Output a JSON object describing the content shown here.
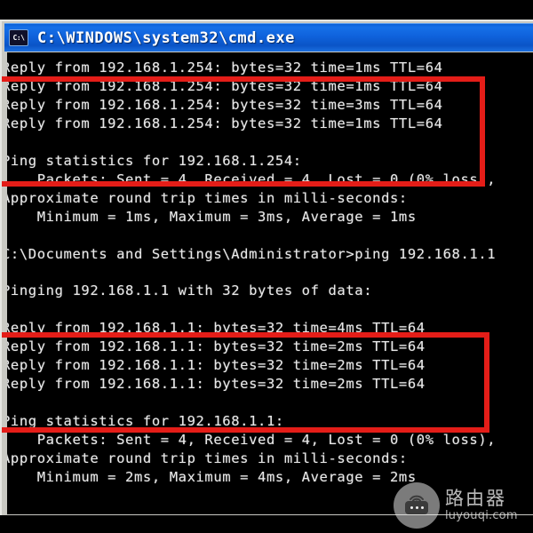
{
  "window": {
    "title": "C:\\WINDOWS\\system32\\cmd.exe",
    "icon_label": "C:\\",
    "icon_name": "cmd-icon"
  },
  "console": {
    "lines": [
      "Reply from 192.168.1.254: bytes=32 time=1ms TTL=64",
      "Reply from 192.168.1.254: bytes=32 time=1ms TTL=64",
      "Reply from 192.168.1.254: bytes=32 time=3ms TTL=64",
      "Reply from 192.168.1.254: bytes=32 time=1ms TTL=64",
      "",
      "Ping statistics for 192.168.1.254:",
      "    Packets: Sent = 4, Received = 4, Lost = 0 (0% loss),",
      "Approximate round trip times in milli-seconds:",
      "    Minimum = 1ms, Maximum = 3ms, Average = 1ms",
      "",
      "C:\\Documents and Settings\\Administrator>ping 192.168.1.1",
      "",
      "Pinging 192.168.1.1 with 32 bytes of data:",
      "",
      "Reply from 192.168.1.1: bytes=32 time=4ms TTL=64",
      "Reply from 192.168.1.1: bytes=32 time=2ms TTL=64",
      "Reply from 192.168.1.1: bytes=32 time=2ms TTL=64",
      "Reply from 192.168.1.1: bytes=32 time=2ms TTL=64",
      "",
      "Ping statistics for 192.168.1.1:",
      "    Packets: Sent = 4, Received = 4, Lost = 0 (0% loss),",
      "Approximate round trip times in milli-seconds:",
      "    Minimum = 2ms, Maximum = 4ms, Average = 2ms"
    ]
  },
  "annotations": {
    "box_color": "#e41d18",
    "boxes": [
      {
        "name": "highlight-replies-254",
        "label": ""
      },
      {
        "name": "highlight-replies-1",
        "label": ""
      }
    ]
  },
  "watermark": {
    "brand_cn": "路由器",
    "url": "luyouqi.com"
  },
  "colors": {
    "titlebar_blue": "#0f62dc",
    "console_bg": "#000000",
    "console_fg": "#e8e8e8",
    "annotation_red": "#e41d18"
  }
}
